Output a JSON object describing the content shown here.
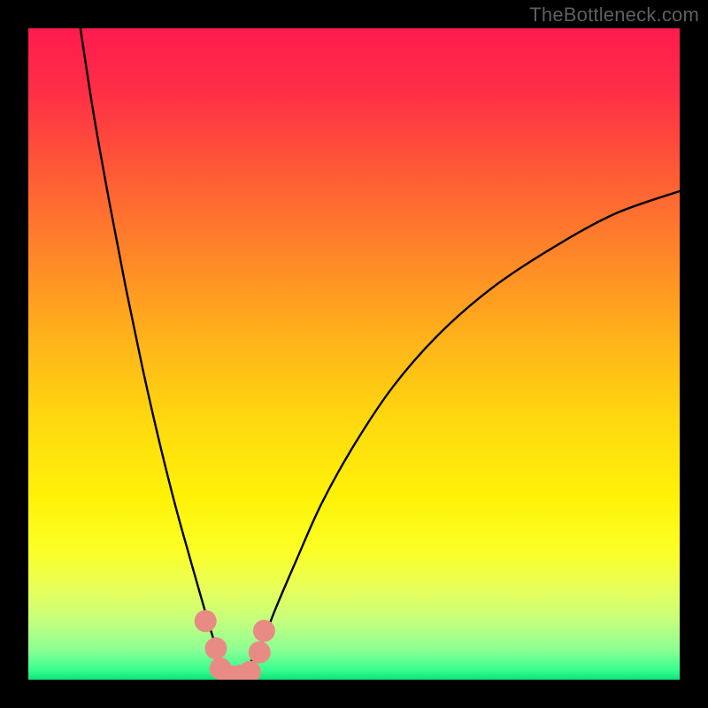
{
  "watermark": {
    "text": "TheBottleneck.com"
  },
  "gradient": {
    "stops": [
      {
        "offset": 0.0,
        "color": "#ff1b4e"
      },
      {
        "offset": 0.1,
        "color": "#ff2f46"
      },
      {
        "offset": 0.22,
        "color": "#ff5a36"
      },
      {
        "offset": 0.35,
        "color": "#ff8728"
      },
      {
        "offset": 0.48,
        "color": "#ffb41a"
      },
      {
        "offset": 0.6,
        "color": "#ffd80f"
      },
      {
        "offset": 0.72,
        "color": "#fff208"
      },
      {
        "offset": 0.8,
        "color": "#fcff25"
      },
      {
        "offset": 0.86,
        "color": "#e8ff5a"
      },
      {
        "offset": 0.91,
        "color": "#c4ff7e"
      },
      {
        "offset": 0.955,
        "color": "#8bff94"
      },
      {
        "offset": 0.985,
        "color": "#37ff8f"
      },
      {
        "offset": 1.0,
        "color": "#11e07a"
      }
    ]
  },
  "chart_data": {
    "type": "line",
    "title": "",
    "xlabel": "",
    "ylabel": "",
    "xlim": [
      0,
      100
    ],
    "ylim": [
      0,
      100
    ],
    "grid": false,
    "series": [
      {
        "name": "bottleneck-curve",
        "color": "#000000",
        "x": [
          8.0,
          10.0,
          12.5,
          15.0,
          17.5,
          20.0,
          22.5,
          25.0,
          27.0,
          28.5,
          29.5,
          30.3,
          31.0,
          32.5,
          34.0,
          36.0,
          38.0,
          41.0,
          45.0,
          50.0,
          56.0,
          63.0,
          71.0,
          80.0,
          90.0,
          100.0
        ],
        "y": [
          100.0,
          87.0,
          73.0,
          60.0,
          48.0,
          37.0,
          27.0,
          18.0,
          11.0,
          6.0,
          3.0,
          1.2,
          0.5,
          0.8,
          2.5,
          6.0,
          11.0,
          18.0,
          27.0,
          36.0,
          45.0,
          53.0,
          60.0,
          66.0,
          71.5,
          75.0
        ]
      }
    ],
    "markers": [
      {
        "x": 27.2,
        "y": 9.0,
        "color": "#e98b85",
        "r": 1.7
      },
      {
        "x": 28.8,
        "y": 4.8,
        "color": "#e98b85",
        "r": 1.7
      },
      {
        "x": 29.5,
        "y": 1.7,
        "color": "#e98b85",
        "r": 1.7
      },
      {
        "x": 30.8,
        "y": 0.6,
        "color": "#e98b85",
        "r": 1.7
      },
      {
        "x": 32.5,
        "y": 0.6,
        "color": "#e98b85",
        "r": 1.7
      },
      {
        "x": 34.0,
        "y": 1.2,
        "color": "#e98b85",
        "r": 1.7
      },
      {
        "x": 35.5,
        "y": 4.2,
        "color": "#e98b85",
        "r": 1.7
      },
      {
        "x": 36.2,
        "y": 7.5,
        "color": "#e98b85",
        "r": 1.7
      }
    ]
  }
}
